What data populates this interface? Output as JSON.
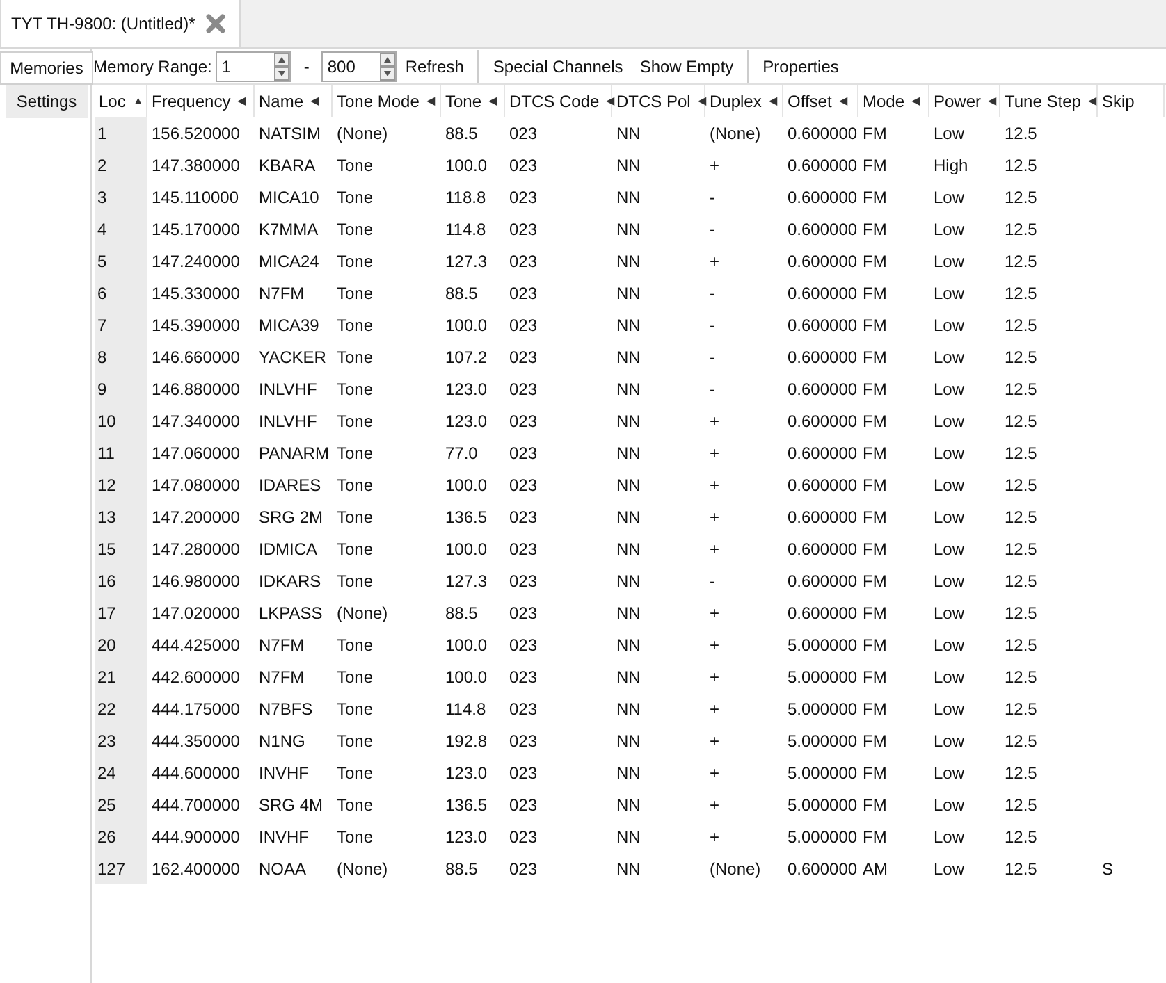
{
  "tab": {
    "title": "TYT TH-9800: (Untitled)*"
  },
  "side_tabs": [
    {
      "label": "Memories",
      "selected": true
    },
    {
      "label": "Settings",
      "selected": false
    }
  ],
  "toolbar": {
    "range_label": "Memory Range:",
    "range_start": "1",
    "separator": "-",
    "range_end": "800",
    "buttons": [
      "Refresh",
      "Special Channels",
      "Show Empty",
      "Properties"
    ]
  },
  "table": {
    "columns": [
      {
        "label": "Loc",
        "indicator": "▲"
      },
      {
        "label": "Frequency",
        "indicator": "◀"
      },
      {
        "label": "Name",
        "indicator": "◀"
      },
      {
        "label": "Tone Mode",
        "indicator": "◀"
      },
      {
        "label": "Tone",
        "indicator": "◀"
      },
      {
        "label": "DTCS Code",
        "indicator": "◀"
      },
      {
        "label": "DTCS Pol",
        "indicator": "◀"
      },
      {
        "label": "Duplex",
        "indicator": "◀"
      },
      {
        "label": "Offset",
        "indicator": "◀"
      },
      {
        "label": "Mode",
        "indicator": "◀"
      },
      {
        "label": "Power",
        "indicator": "◀"
      },
      {
        "label": "Tune Step",
        "indicator": "◀"
      },
      {
        "label": "Skip"
      }
    ],
    "rows": [
      [
        "1",
        "156.520000",
        "NATSIM",
        "(None)",
        "88.5",
        "023",
        "NN",
        "(None)",
        "0.600000",
        "FM",
        "Low",
        "12.5"
      ],
      [
        "2",
        "147.380000",
        "KBARA",
        "Tone",
        "100.0",
        "023",
        "NN",
        "+",
        "0.600000",
        "FM",
        "High",
        "12.5"
      ],
      [
        "3",
        "145.110000",
        "MICA10",
        "Tone",
        "118.8",
        "023",
        "NN",
        "-",
        "0.600000",
        "FM",
        "Low",
        "12.5"
      ],
      [
        "4",
        "145.170000",
        "K7MMA",
        "Tone",
        "114.8",
        "023",
        "NN",
        "-",
        "0.600000",
        "FM",
        "Low",
        "12.5"
      ],
      [
        "5",
        "147.240000",
        "MICA24",
        "Tone",
        "127.3",
        "023",
        "NN",
        "+",
        "0.600000",
        "FM",
        "Low",
        "12.5"
      ],
      [
        "6",
        "145.330000",
        "N7FM",
        "Tone",
        "88.5",
        "023",
        "NN",
        "-",
        "0.600000",
        "FM",
        "Low",
        "12.5"
      ],
      [
        "7",
        "145.390000",
        "MICA39",
        "Tone",
        "100.0",
        "023",
        "NN",
        "-",
        "0.600000",
        "FM",
        "Low",
        "12.5"
      ],
      [
        "8",
        "146.660000",
        "YACKER",
        "Tone",
        "107.2",
        "023",
        "NN",
        "-",
        "0.600000",
        "FM",
        "Low",
        "12.5"
      ],
      [
        "9",
        "146.880000",
        "INLVHF",
        "Tone",
        "123.0",
        "023",
        "NN",
        "-",
        "0.600000",
        "FM",
        "Low",
        "12.5"
      ],
      [
        "10",
        "147.340000",
        "INLVHF",
        "Tone",
        "123.0",
        "023",
        "NN",
        "+",
        "0.600000",
        "FM",
        "Low",
        "12.5"
      ],
      [
        "11",
        "147.060000",
        "PANARM",
        "Tone",
        "77.0",
        "023",
        "NN",
        "+",
        "0.600000",
        "FM",
        "Low",
        "12.5"
      ],
      [
        "12",
        "147.080000",
        "IDARES",
        "Tone",
        "100.0",
        "023",
        "NN",
        "+",
        "0.600000",
        "FM",
        "Low",
        "12.5"
      ],
      [
        "13",
        "147.200000",
        "SRG 2M",
        "Tone",
        "136.5",
        "023",
        "NN",
        "+",
        "0.600000",
        "FM",
        "Low",
        "12.5"
      ],
      [
        "15",
        "147.280000",
        "IDMICA",
        "Tone",
        "100.0",
        "023",
        "NN",
        "+",
        "0.600000",
        "FM",
        "Low",
        "12.5"
      ],
      [
        "16",
        "146.980000",
        "IDKARS",
        "Tone",
        "127.3",
        "023",
        "NN",
        "-",
        "0.600000",
        "FM",
        "Low",
        "12.5"
      ],
      [
        "17",
        "147.020000",
        "LKPASS",
        "(None)",
        "88.5",
        "023",
        "NN",
        "+",
        "0.600000",
        "FM",
        "Low",
        "12.5"
      ],
      [
        "20",
        "444.425000",
        "N7FM",
        "Tone",
        "100.0",
        "023",
        "NN",
        "+",
        "5.000000",
        "FM",
        "Low",
        "12.5"
      ],
      [
        "21",
        "442.600000",
        "N7FM",
        "Tone",
        "100.0",
        "023",
        "NN",
        "+",
        "5.000000",
        "FM",
        "Low",
        "12.5"
      ],
      [
        "22",
        "444.175000",
        "N7BFS",
        "Tone",
        "114.8",
        "023",
        "NN",
        "+",
        "5.000000",
        "FM",
        "Low",
        "12.5"
      ],
      [
        "23",
        "444.350000",
        "N1NG",
        "Tone",
        "192.8",
        "023",
        "NN",
        "+",
        "5.000000",
        "FM",
        "Low",
        "12.5"
      ],
      [
        "24",
        "444.600000",
        "INVHF",
        "Tone",
        "123.0",
        "023",
        "NN",
        "+",
        "5.000000",
        "FM",
        "Low",
        "12.5"
      ],
      [
        "25",
        "444.700000",
        "SRG 4M",
        "Tone",
        "136.5",
        "023",
        "NN",
        "+",
        "5.000000",
        "FM",
        "Low",
        "12.5"
      ],
      [
        "26",
        "444.900000",
        "INVHF",
        "Tone",
        "123.0",
        "023",
        "NN",
        "+",
        "5.000000",
        "FM",
        "Low",
        "12.5"
      ],
      [
        "127",
        "162.400000",
        "NOAA",
        "(None)",
        "88.5",
        "023",
        "NN",
        "(None)",
        "0.600000",
        "AM",
        "Low",
        "12.5",
        "S"
      ]
    ]
  }
}
